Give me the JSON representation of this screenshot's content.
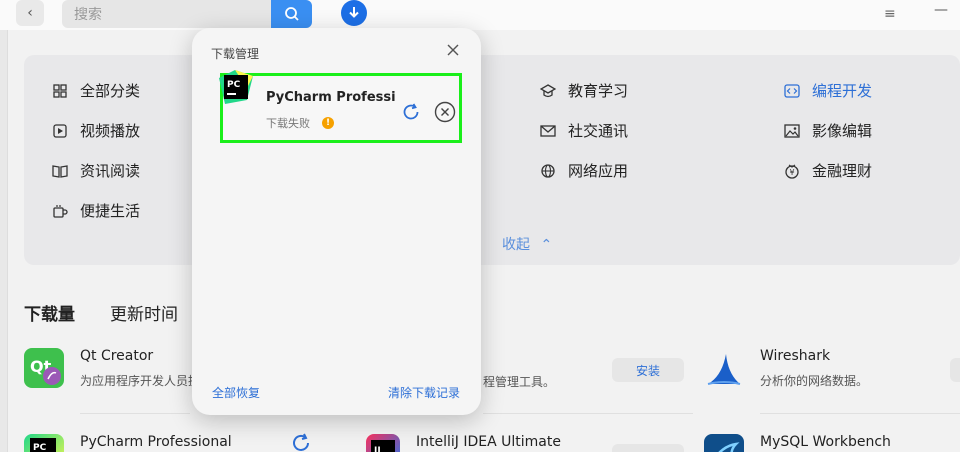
{
  "header": {
    "search_placeholder": "搜索",
    "icons": [
      "back-icon",
      "search-icon",
      "download-icon",
      "menu-icon",
      "minimize-icon"
    ]
  },
  "categories": [
    {
      "label": "全部分类",
      "icon": "grid-icon"
    },
    {
      "label": "视频播放",
      "icon": "play-icon"
    },
    {
      "label": "资讯阅读",
      "icon": "book-icon"
    },
    {
      "label": "便捷生活",
      "icon": "cup-icon"
    },
    {
      "label": "教育学习",
      "icon": "graduation-icon"
    },
    {
      "label": "社交通讯",
      "icon": "mail-icon"
    },
    {
      "label": "网络应用",
      "icon": "globe-icon"
    },
    {
      "label": "编程开发",
      "icon": "code-icon"
    },
    {
      "label": "影像编辑",
      "icon": "image-icon"
    },
    {
      "label": "金融理财",
      "icon": "coin-icon"
    }
  ],
  "collapse_label": "收起",
  "tabs": [
    {
      "label": "下载量"
    },
    {
      "label": "更新时间"
    }
  ],
  "apps": [
    {
      "name": "Qt Creator",
      "desc": "为应用程序开发人员提"
    },
    {
      "name": "",
      "desc": "程管理工具。",
      "button": "安装"
    },
    {
      "name": "Wireshark",
      "desc": "分析你的网络数据。"
    },
    {
      "name": "PyCharm Professional",
      "desc": ""
    },
    {
      "name": "IntelliJ IDEA Ultimate",
      "desc": ""
    },
    {
      "name": "MySQL Workbench",
      "desc": ""
    }
  ],
  "dialog": {
    "title": "下载管理",
    "item": {
      "name": "PyCharm Professio…",
      "status": "下载失败"
    },
    "restore_all": "全部恢复",
    "clear_records": "清除下载记录"
  },
  "colors": {
    "accent": "#2d6fd6",
    "search_button": "#3a8ff2",
    "highlight": "#1aef1a",
    "warning": "#f6a100"
  }
}
